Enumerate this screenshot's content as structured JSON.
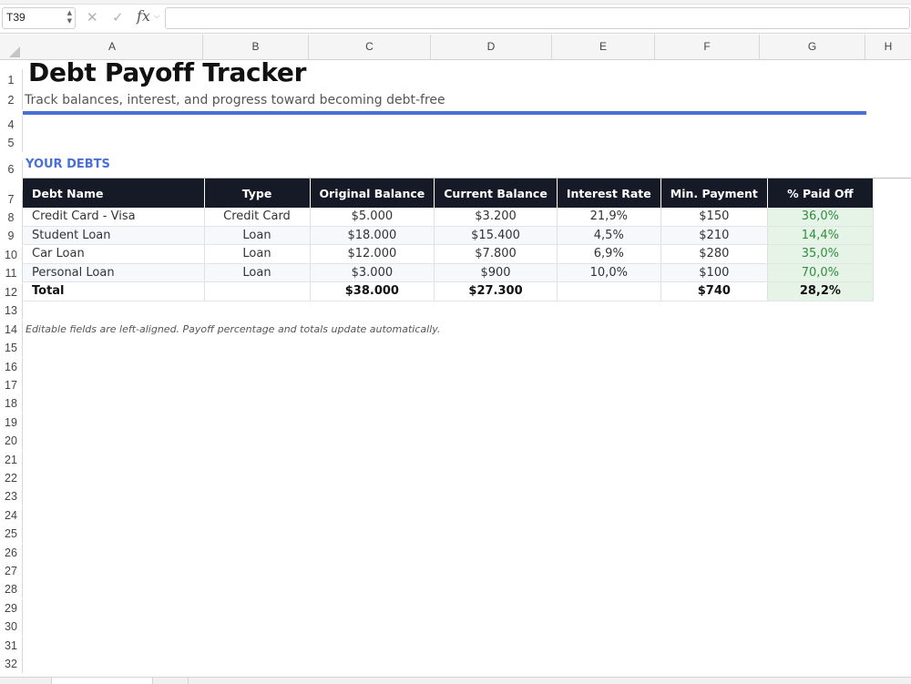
{
  "formula_bar": {
    "name_box": "T39",
    "fx_label": "fx",
    "formula": ""
  },
  "columns": [
    "A",
    "B",
    "C",
    "D",
    "E",
    "F",
    "G",
    "H"
  ],
  "rows": [
    "1",
    "2",
    "4",
    "5",
    "6",
    "7",
    "8",
    "9",
    "10",
    "11",
    "12",
    "13",
    "14",
    "15",
    "16",
    "17",
    "18",
    "19",
    "20",
    "21",
    "22",
    "23",
    "24",
    "25",
    "26",
    "27",
    "28",
    "29",
    "30",
    "31",
    "32"
  ],
  "sheet": {
    "title": "Debt Payoff Tracker",
    "subtitle": "Track balances, interest, and progress toward becoming debt-free",
    "section_label": "YOUR DEBTS",
    "note": "Editable fields are left-aligned. Payoff percentage and totals update automatically.",
    "accent_color": "#4a6fd6",
    "header_bg_color": "#161a27",
    "positive_color": "#2f8f3e"
  },
  "table": {
    "headers": [
      "Debt Name",
      "Type",
      "Original Balance",
      "Current Balance",
      "Interest Rate",
      "Min. Payment",
      "% Paid Off"
    ],
    "rows": [
      [
        "Credit Card - Visa",
        "Credit Card",
        "$5.000",
        "$3.200",
        "21,9%",
        "$150",
        "36,0%"
      ],
      [
        "Student Loan",
        "Loan",
        "$18.000",
        "$15.400",
        "4,5%",
        "$210",
        "14,4%"
      ],
      [
        "Car Loan",
        "Loan",
        "$12.000",
        "$7.800",
        "6,9%",
        "$280",
        "35,0%"
      ],
      [
        "Personal Loan",
        "Loan",
        "$3.000",
        "$900",
        "10,0%",
        "$100",
        "70,0%"
      ]
    ],
    "total": [
      "Total",
      "",
      "$38.000",
      "$27.300",
      "",
      "$740",
      "28,2%"
    ]
  }
}
